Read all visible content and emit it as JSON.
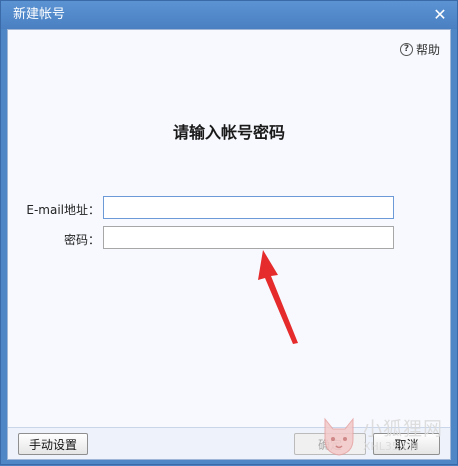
{
  "window": {
    "title": "新建帐号",
    "close_glyph": "✕"
  },
  "help": {
    "label": "帮助",
    "icon": "help-circle-icon"
  },
  "heading": "请输入帐号密码",
  "fields": {
    "email": {
      "label": "E-mail地址：",
      "value": "",
      "placeholder": ""
    },
    "password": {
      "label": "密码：",
      "value": "",
      "placeholder": ""
    }
  },
  "footer": {
    "manual_label": "手动设置",
    "ok_label": "确定",
    "cancel_label": "取消"
  },
  "watermark": {
    "cn": "小狐狸网",
    "en": "XHL35.CN"
  },
  "colors": {
    "titlebar": "#4f86c6",
    "client_bg": "#f7f9fe",
    "arrow": "#e52b2b"
  }
}
